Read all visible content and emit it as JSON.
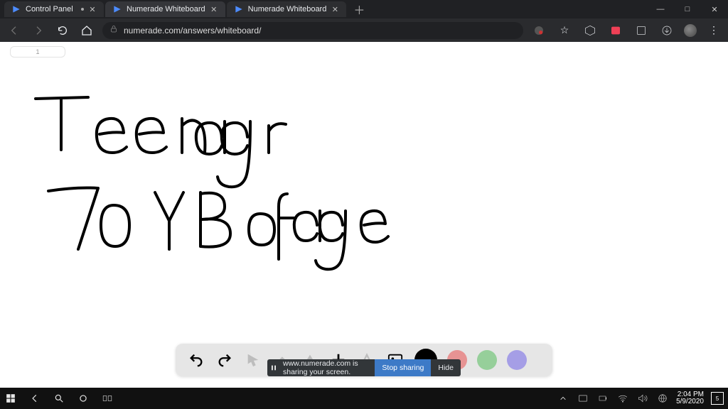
{
  "tabs": [
    {
      "title": "Control Panel",
      "active": false,
      "has_dot": true
    },
    {
      "title": "Numerade Whiteboard",
      "active": true,
      "has_dot": false
    },
    {
      "title": "Numerade Whiteboard",
      "active": false,
      "has_dot": false
    }
  ],
  "address_bar": {
    "url": "numerade.com/answers/whiteboard/"
  },
  "slide_thumb_label": "1",
  "handwriting_lines": [
    "Teenager",
    "70 YB of age"
  ],
  "share_banner": {
    "message": "www.numerade.com is sharing your screen.",
    "stop_label": "Stop sharing",
    "hide_label": "Hide"
  },
  "whiteboard_colors": {
    "pen_black": "#000000",
    "pen_red": "#e79393",
    "pen_green": "#96cf9a",
    "pen_purple": "#a59ee6"
  },
  "clock": {
    "time": "2:04 PM",
    "date": "5/9/2020"
  },
  "notification_count": "5"
}
